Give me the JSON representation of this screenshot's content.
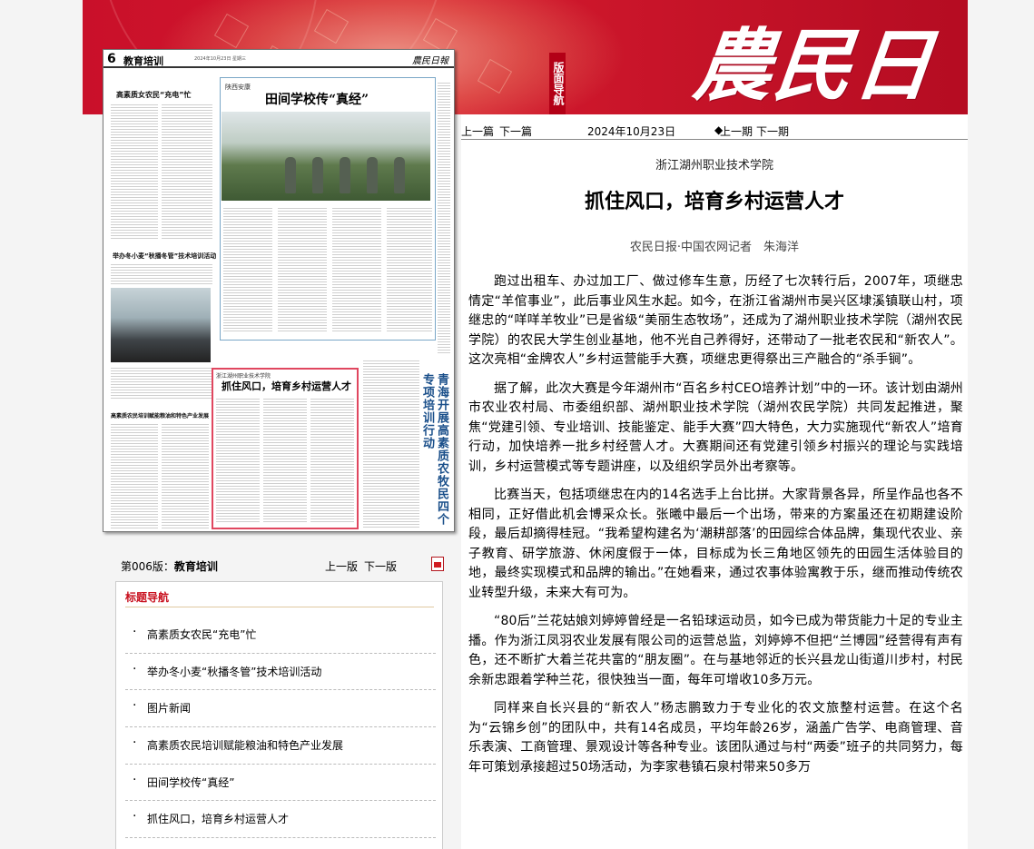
{
  "banner": {
    "paper_name": "農民日報",
    "nav_badge": "版面导航"
  },
  "thumbnail": {
    "page_no": "6",
    "section": "教育培训",
    "meta": "2024年10月23日 星期三",
    "mini_logo": "農民日報",
    "feature_kicker": "陕西安康",
    "feature_title": "田间学校传“真经”",
    "left_head_1": "高素质女农民“充电”忙",
    "left_head_2": "举办冬小麦“秋播冬管”技术培训活动",
    "left_head_3": "高素质农民培训赋能粮油和特色产业发展",
    "highlight_kicker": "浙江湖州职业技术学院",
    "highlight_title": "抓住风口，培育乡村运营人才",
    "vertical_text": "青海开展高素质农牧民四个专项培训行动"
  },
  "page_info": {
    "label_prefix": "第006版：",
    "label_section": "教育培训",
    "prev": "上一版",
    "next": "下一版"
  },
  "headline_nav": {
    "title": "标题导航",
    "items": [
      "高素质女农民“充电”忙",
      "举办冬小麦“秋播冬管”技术培训活动",
      "图片新闻",
      "高素质农民培训赋能粮油和特色产业发展",
      "田间学校传“真经”",
      "抓住风口，培育乡村运营人才"
    ]
  },
  "article": {
    "toolbar": {
      "prev_article": "上一篇",
      "next_article": "下一篇",
      "date": "2024年10月23日",
      "prev_issue": "上一期",
      "next_issue": "下一期"
    },
    "kicker": "浙江湖州职业技术学院",
    "headline": "抓住风口，培育乡村运营人才",
    "byline": "农民日报·中国农网记者　朱海洋",
    "paragraphs": [
      "跑过出租车、办过加工厂、做过修车生意，历经了七次转行后，2007年，项继忠情定“羊倌事业”，此后事业风生水起。如今，在浙江省湖州市吴兴区埭溪镇联山村，项继忠的“咩咩羊牧业”已是省级“美丽生态牧场”，还成为了湖州职业技术学院（湖州农民学院）的农民大学生创业基地，他不光自己养得好，还带动了一批老农民和“新农人”。这次亮相“金牌农人”乡村运营能手大赛，项继忠更得祭出三产融合的“杀手锏”。",
      "据了解，此次大赛是今年湖州市“百名乡村CEO培养计划”中的一环。该计划由湖州市农业农村局、市委组织部、湖州职业技术学院（湖州农民学院）共同发起推进，聚焦“党建引领、专业培训、技能鉴定、能手大赛”四大特色，大力实施现代“新农人”培育行动，加快培养一批乡村经营人才。大赛期间还有党建引领乡村振兴的理论与实践培训，乡村运营模式等专题讲座，以及组织学员外出考察等。",
      "比赛当天，包括项继忠在内的14名选手上台比拼。大家背景各异，所呈作品也各不相同，正好借此机会博采众长。张曦中最后一个出场，带来的方案虽还在初期建设阶段，最后却摘得桂冠。“我希望构建名为‘潮耕部落’的田园综合体品牌，集现代农业、亲子教育、研学旅游、休闲度假于一体，目标成为长三角地区领先的田园生活体验目的地，最终实现模式和品牌的输出。”在她看来，通过农事体验寓教于乐，继而推动传统农业转型升级，未来大有可为。",
      "“80后”兰花姑娘刘婷婷曾经是一名铅球运动员，如今已成为带货能力十足的专业主播。作为浙江凤羽农业发展有限公司的运营总监，刘婷婷不但把“兰博园”经营得有声有色，还不断扩大着兰花共富的“朋友圈”。在与基地邻近的长兴县龙山街道川步村，村民余新忠跟着学种兰花，很快独当一面，每年可增收10多万元。",
      "同样来自长兴县的“新农人”杨志鹏致力于专业化的农文旅整村运营。在这个名为“云锦乡创”的团队中，共有14名成员，平均年龄26岁，涵盖广告学、电商管理、音乐表演、工商管理、景观设计等各种专业。该团队通过与村“两委”班子的共同努力，每年可策划承接超过50场活动，为李家巷镇石泉村带来50多万"
    ]
  }
}
